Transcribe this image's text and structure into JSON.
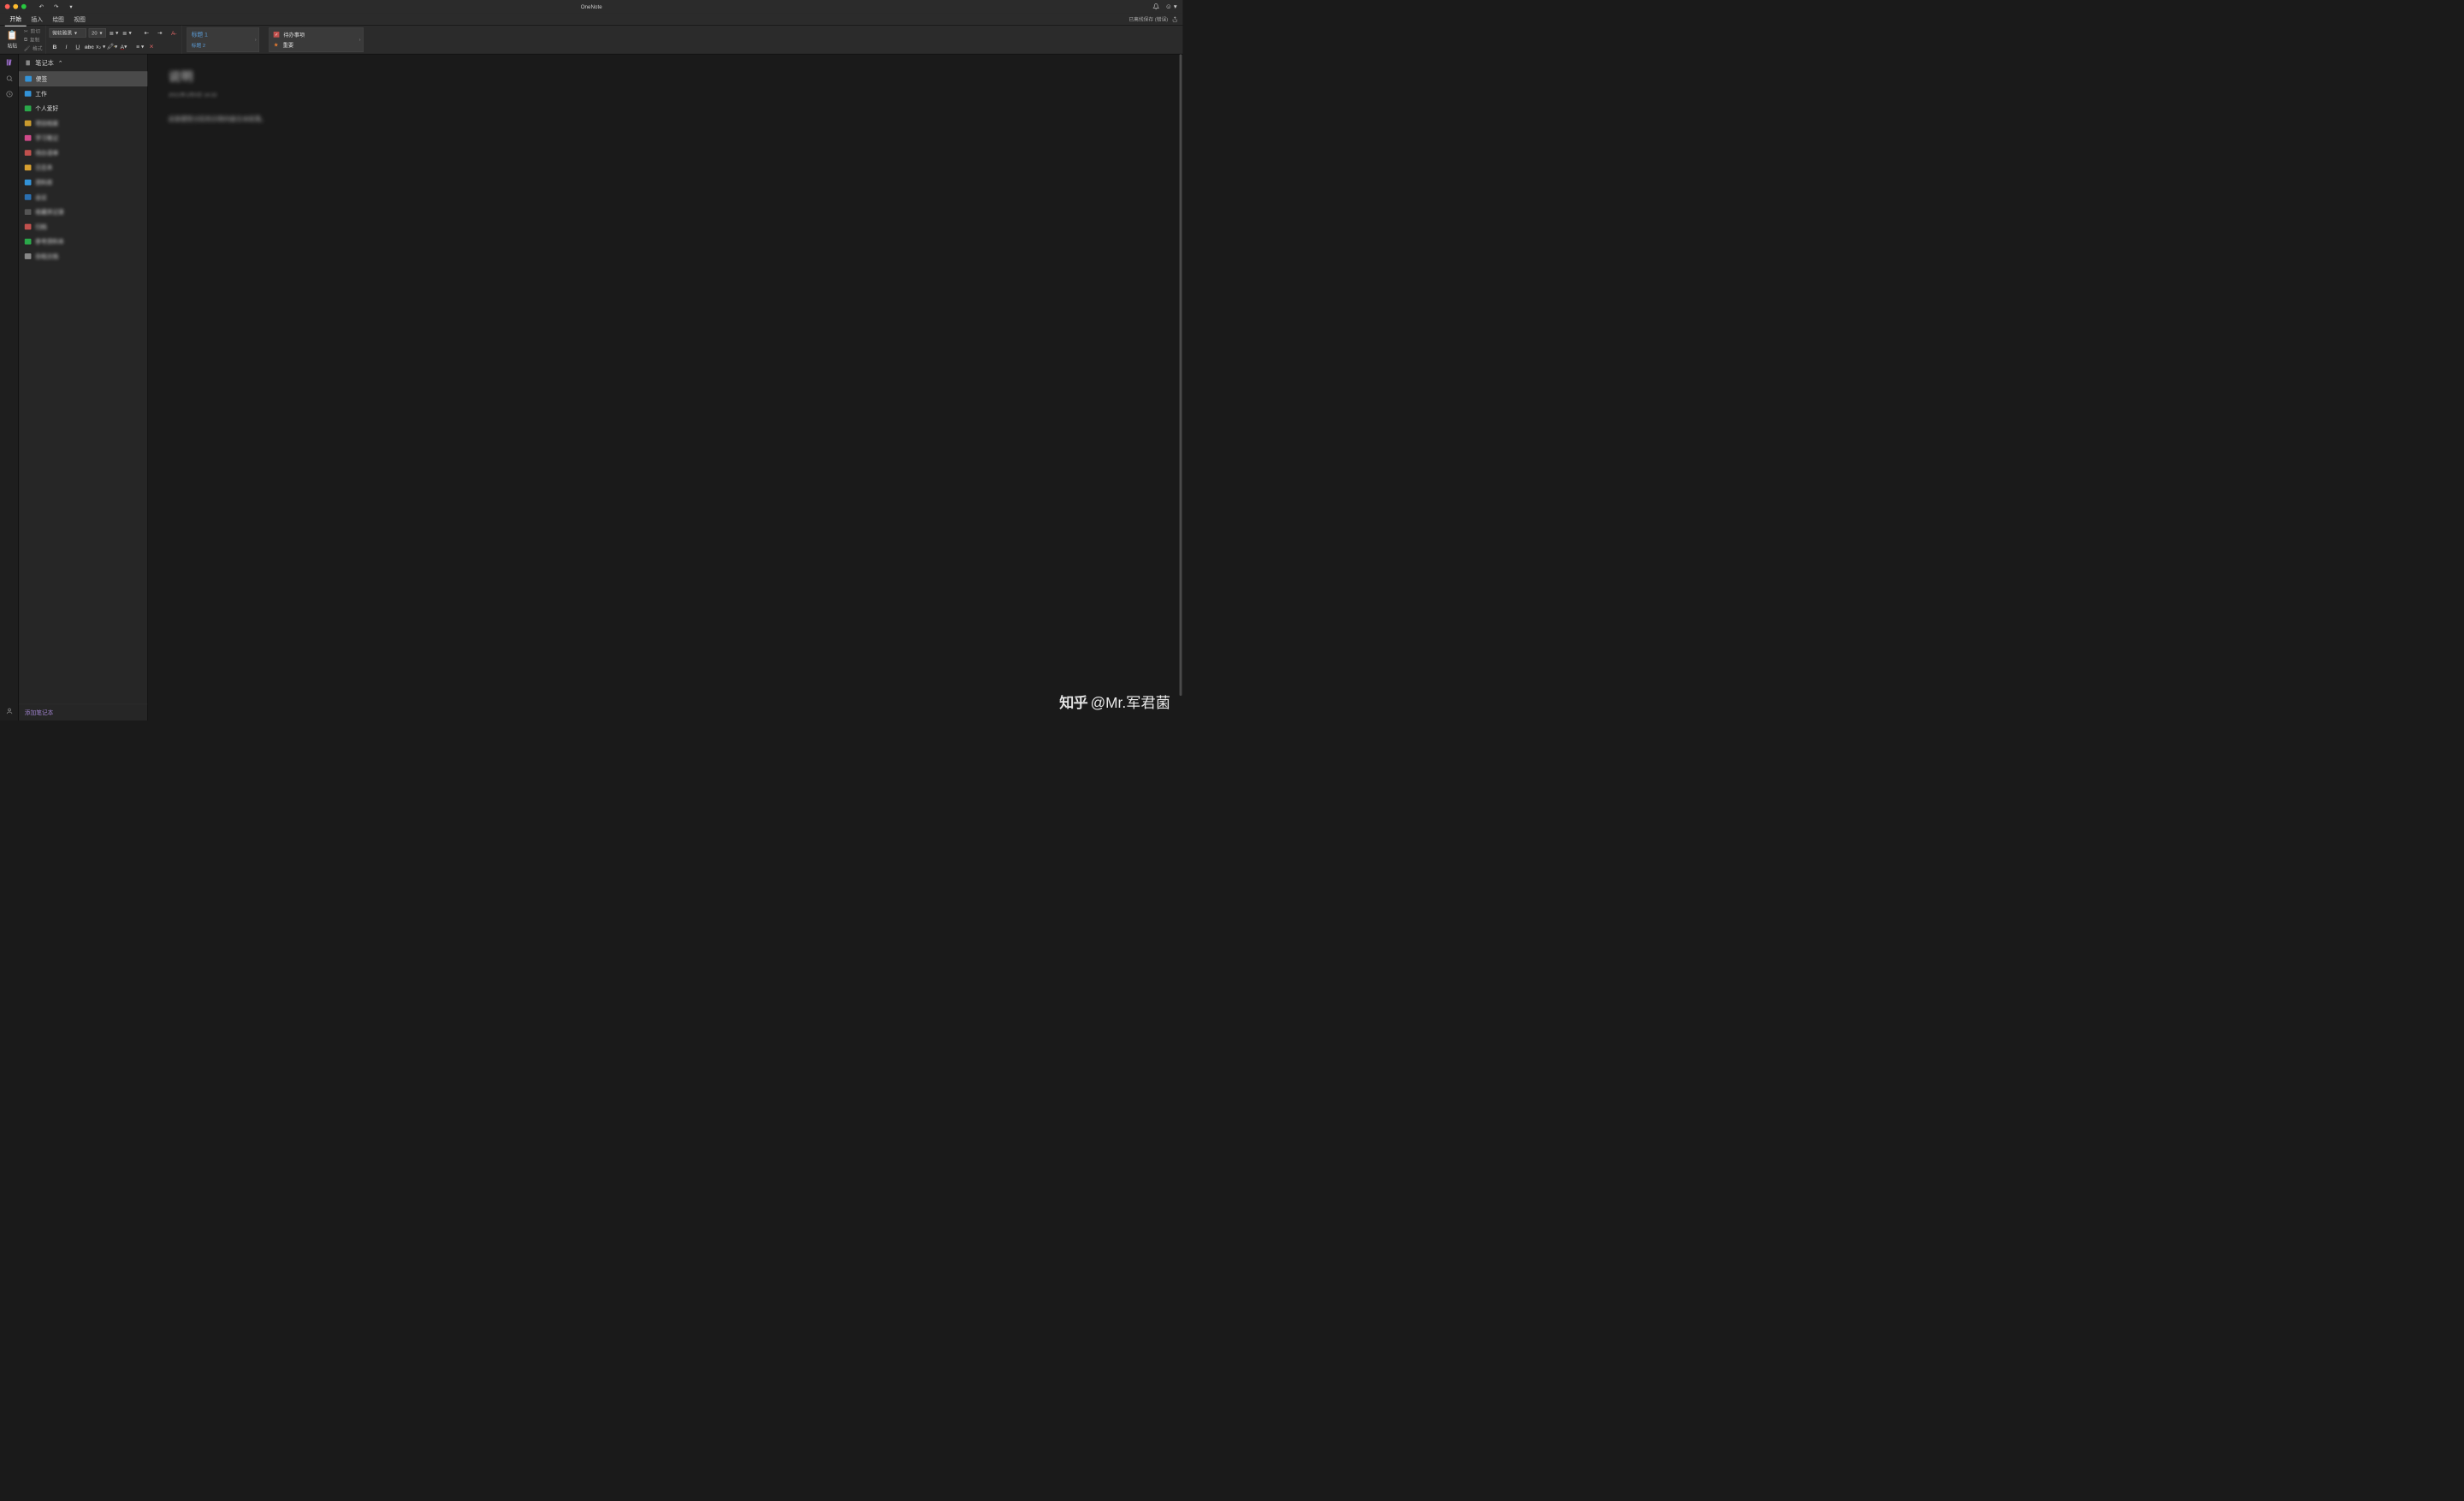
{
  "titlebar": {
    "title": "OneNote"
  },
  "tabs": {
    "items": [
      "开始",
      "插入",
      "绘图",
      "视图"
    ],
    "active": 0,
    "sync_status": "已离线保存 (错误)"
  },
  "ribbon": {
    "paste_label": "粘贴",
    "cut_label": "剪切",
    "copy_label": "复制",
    "format_label": "格式",
    "font_name": "微软雅黑",
    "font_size": "20",
    "style1": "标题 1",
    "style2": "标题 2",
    "tag_todo": "待办事项",
    "tag_important": "重要"
  },
  "sidebar": {
    "header": "笔记本",
    "items": [
      {
        "label": "便签",
        "color": "#3393d8",
        "blurred": false,
        "selected": true
      },
      {
        "label": "工作",
        "color": "#3393d8",
        "blurred": false,
        "selected": false
      },
      {
        "label": "个人爱好",
        "color": "#2aa84a",
        "blurred": false,
        "selected": false
      },
      {
        "label": "项目档案",
        "color": "#c99a2e",
        "blurred": true,
        "selected": false
      },
      {
        "label": "学习笔记",
        "color": "#d04a8a",
        "blurred": true,
        "selected": false
      },
      {
        "label": "待办清单",
        "color": "#c0504d",
        "blurred": true,
        "selected": false
      },
      {
        "label": "日志本",
        "color": "#d8a030",
        "blurred": true,
        "selected": false
      },
      {
        "label": "资料库",
        "color": "#3393d8",
        "blurred": true,
        "selected": false
      },
      {
        "label": "会议",
        "color": "#2a6fb0",
        "blurred": true,
        "selected": false
      },
      {
        "label": "收藏夹记录",
        "color": "#555555",
        "blurred": true,
        "selected": false
      },
      {
        "label": "归档",
        "color": "#c0504d",
        "blurred": true,
        "selected": false
      },
      {
        "label": "参考资料本",
        "color": "#2aa84a",
        "blurred": true,
        "selected": false
      },
      {
        "label": "存档文档",
        "color": "#888888",
        "blurred": true,
        "selected": false
      }
    ],
    "add_label": "添加笔记本"
  },
  "note": {
    "title": "说明",
    "meta": "2021年1月5日    14:32",
    "body": "这是便签分区的示例内容文本段落。"
  },
  "watermark": {
    "logo": "知乎",
    "handle": "@Mr.军君菌"
  }
}
